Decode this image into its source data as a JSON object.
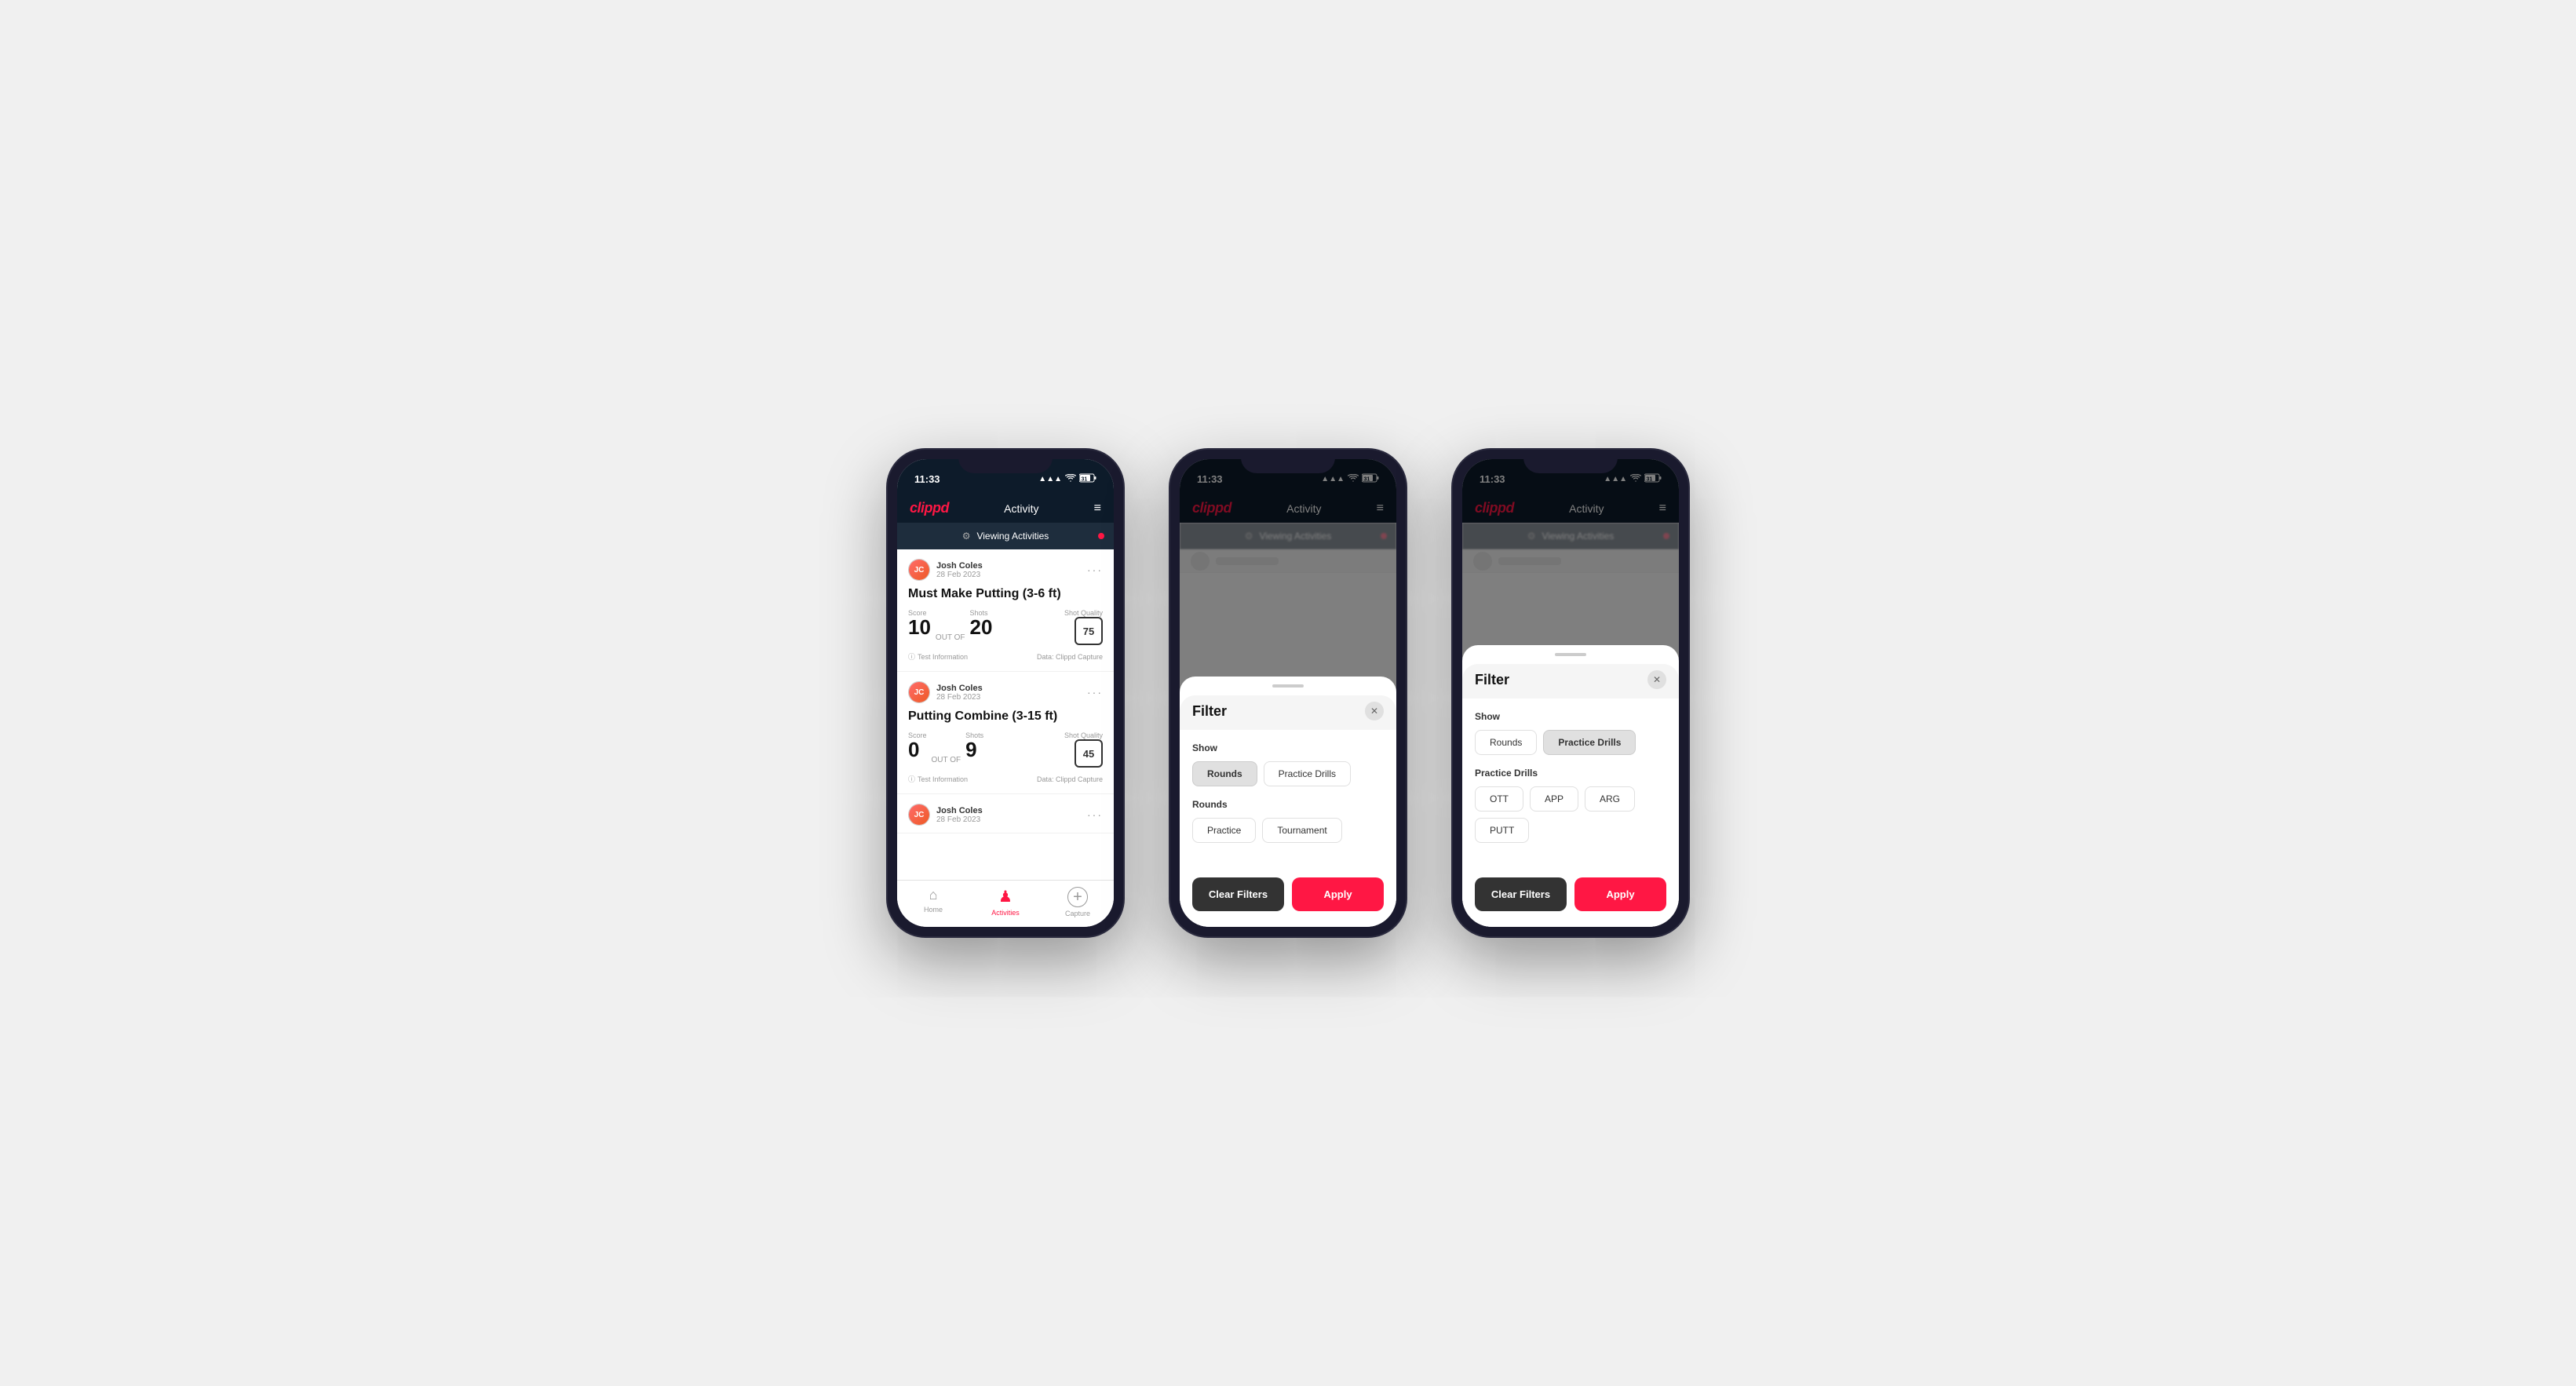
{
  "app": {
    "logo": "clippd",
    "title": "Activity",
    "time": "11:33",
    "signal": "▲▲▲",
    "wifi": "WiFi",
    "battery": "31"
  },
  "banner": {
    "icon": "⚙",
    "text": "Viewing Activities"
  },
  "phone1": {
    "cards": [
      {
        "user_name": "Josh Coles",
        "user_date": "28 Feb 2023",
        "activity_title": "Must Make Putting (3-6 ft)",
        "score_label": "Score",
        "score_value": "10",
        "out_of_label": "OUT OF",
        "shots_label": "Shots",
        "shots_value": "20",
        "shot_quality_label": "Shot Quality",
        "shot_quality_value": "75",
        "info": "Test Information",
        "data": "Data: Clippd Capture"
      },
      {
        "user_name": "Josh Coles",
        "user_date": "28 Feb 2023",
        "activity_title": "Putting Combine (3-15 ft)",
        "score_label": "Score",
        "score_value": "0",
        "out_of_label": "OUT OF",
        "shots_label": "Shots",
        "shots_value": "9",
        "shot_quality_label": "Shot Quality",
        "shot_quality_value": "45",
        "info": "Test Information",
        "data": "Data: Clippd Capture"
      },
      {
        "user_name": "Josh Coles",
        "user_date": "28 Feb 2023",
        "activity_title": "",
        "score_label": "",
        "score_value": "",
        "out_of_label": "",
        "shots_label": "",
        "shots_value": "",
        "shot_quality_label": "",
        "shot_quality_value": "",
        "info": "",
        "data": ""
      }
    ],
    "tabs": [
      {
        "label": "Home",
        "icon": "⌂",
        "active": false
      },
      {
        "label": "Activities",
        "icon": "👤",
        "active": true
      },
      {
        "label": "Capture",
        "icon": "+",
        "active": false
      }
    ]
  },
  "phone2": {
    "filter": {
      "title": "Filter",
      "show_label": "Show",
      "show_buttons": [
        {
          "label": "Rounds",
          "active": true
        },
        {
          "label": "Practice Drills",
          "active": false
        }
      ],
      "rounds_label": "Rounds",
      "rounds_buttons": [
        {
          "label": "Practice",
          "active": false
        },
        {
          "label": "Tournament",
          "active": false
        }
      ],
      "clear_label": "Clear Filters",
      "apply_label": "Apply"
    }
  },
  "phone3": {
    "filter": {
      "title": "Filter",
      "show_label": "Show",
      "show_buttons": [
        {
          "label": "Rounds",
          "active": false
        },
        {
          "label": "Practice Drills",
          "active": true
        }
      ],
      "drills_label": "Practice Drills",
      "drills_buttons": [
        {
          "label": "OTT",
          "active": false
        },
        {
          "label": "APP",
          "active": false
        },
        {
          "label": "ARG",
          "active": false
        },
        {
          "label": "PUTT",
          "active": false
        }
      ],
      "clear_label": "Clear Filters",
      "apply_label": "Apply"
    }
  }
}
